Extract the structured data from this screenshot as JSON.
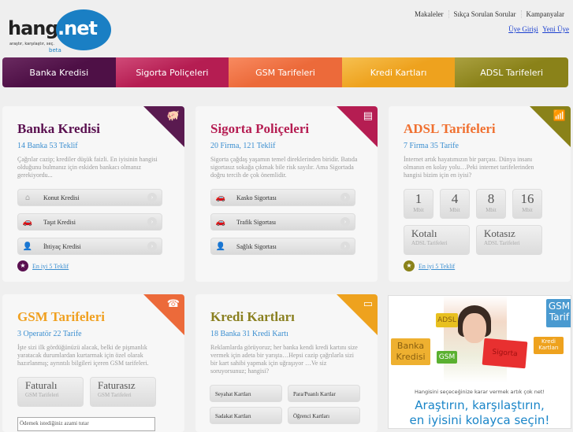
{
  "logo": {
    "name": "hangisi",
    "tld": ".net",
    "tagline": "araştır, karşılaştır, seç.",
    "beta": "beta"
  },
  "toplinks": [
    "Makaleler",
    "Sıkça Sorulan Sorular",
    "Kampanyalar"
  ],
  "userlinks": [
    "Üye Girişi",
    "Yeni Üye"
  ],
  "nav": [
    {
      "label": "Banka Kredisi",
      "color": "#4e1046"
    },
    {
      "label": "Sigorta Poliçeleri",
      "color": "#b51d52"
    },
    {
      "label": "GSM Tarifeleri",
      "color": "#ec6a3a"
    },
    {
      "label": "Kredi Kartları",
      "color": "#eea21e"
    },
    {
      "label": "ADSL Tarifeleri",
      "color": "#8a8219"
    }
  ],
  "banka": {
    "title": "Banka Kredisi",
    "sub": "14 Banka 53 Teklif",
    "desc": "Çağrılar cazip; krediler düşük faizli. En iyisinin hangisi olduğunu bulmanız için eskiden bankacı olmanız gerekiyordu...",
    "buttons": [
      "Konut Kredisi",
      "Taşıt Kredisi",
      "İhtiyaç Kredisi"
    ],
    "best": "En iyi 5 Teklif"
  },
  "sigorta": {
    "title": "Sigorta Poliçeleri",
    "sub": "20 Firma, 121 Teklif",
    "desc": "Sigorta çağdaş yaşamın temel direklerinden biridir. Batıda sigortasız sokağa çıkmak bile risk sayılır. Ama Sigortada doğru tercih de çok önemlidir.",
    "buttons": [
      "Kasko Sigortası",
      "Trafik Sigortası",
      "Sağlık Sigortası"
    ]
  },
  "adsl": {
    "title": "ADSL Tarifeleri",
    "sub": "7 Firma 35 Tarife",
    "desc": "İnternet artık hayatımızın bir parçası. Dünya insanı olmanın en kolay yolu…Peki internet tarifelerinden hangisi bizim için en iyisi?",
    "speeds": [
      "1",
      "4",
      "8",
      "16"
    ],
    "unit": "Mbit",
    "types": [
      "Kotalı",
      "Kotasız"
    ],
    "type_sub": "ADSL Tarifeleri",
    "best": "En iyi 5 Teklif"
  },
  "gsm": {
    "title": "GSM Tarifeleri",
    "sub": "3 Operatör 22 Tarife",
    "desc": "İşte sizi ilk gördüğünüzü alacak, belki de pişmanlık yaratacak durumlardan kurtarmak için özel olarak hazırlanmış; ayrıntılı bilgileri içeren GSM tarifeleri.",
    "types": [
      "Faturalı",
      "Faturasız"
    ],
    "type_sub": "GSM Tarifeleri",
    "input_placeholder": "Ödemek istediğiniz azami tutar"
  },
  "kredi": {
    "title": "Kredi Kartları",
    "sub": "18 Banka 31 Kredi Kartı",
    "desc": "Reklamlarda görüyoruz; her banka kendi kredi kartını size vermek için adeta bir yarışta…Hepsi cazip çağrılarla sizi bir kart sahibi yapmak için uğraşıyor …Ve siz soruyorsunuz; hangisi?",
    "buttons": [
      "Seyahat Kartları",
      "Para/Puanlı Kartlar",
      "Sadakat Kartları",
      "Öğrenci Kartları"
    ]
  },
  "ad": {
    "tags": [
      "Banka Kredisi",
      "ADSL",
      "GSM",
      "Sigorta",
      "GSM Tarif",
      "Kredi Kartları"
    ],
    "line1": "Hangisini seçeceğinize karar vermek artık çok net!",
    "line2": "Araştırın, karşılaştırın,",
    "line3": "en iyisini kolayca seçin!"
  }
}
